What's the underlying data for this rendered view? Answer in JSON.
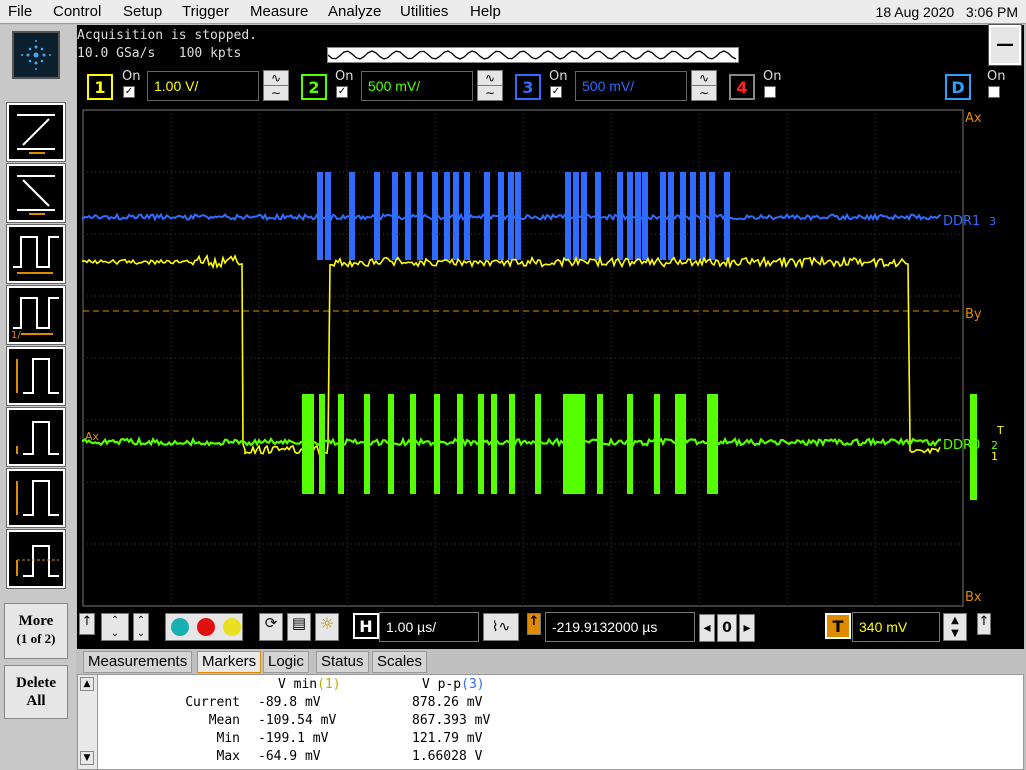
{
  "menu": {
    "items": [
      "File",
      "Control",
      "Setup",
      "Trigger",
      "Measure",
      "Analyze",
      "Utilities",
      "Help"
    ],
    "date": "18 Aug 2020",
    "time": "3:06 PM"
  },
  "acquisition": {
    "status": "Acquisition is stopped.",
    "rate": "10.0 GSa/s",
    "points": "100 kpts"
  },
  "channels": [
    {
      "num": "1",
      "on_label": "On",
      "checked": true,
      "scale": "1.00 V/",
      "color": "#ffff00"
    },
    {
      "num": "2",
      "on_label": "On",
      "checked": true,
      "scale": "500 mV/",
      "color": "#55ff00"
    },
    {
      "num": "3",
      "on_label": "On",
      "checked": true,
      "scale": "500 mV/",
      "color": "#2f6bff"
    },
    {
      "num": "4",
      "on_label": "On",
      "checked": false,
      "scale": "",
      "color": "#ff2020"
    }
  ],
  "digital": {
    "label": "D",
    "on_label": "On",
    "checked": false
  },
  "labels": {
    "ax": "Ax",
    "by": "By",
    "bx": "Bx",
    "ddr1": "DDR1",
    "ddr0": "DDR0",
    "t_marker": "T",
    "ch3_marker": "3",
    "ch2_marker": "2",
    "ch1_marker": "1"
  },
  "left_panel": {
    "more_label": "More",
    "more_sub": "(1 of 2)",
    "delete_label": "Delete",
    "delete_sub": "All"
  },
  "timebase": {
    "h_label": "H",
    "scale": "1.00 µs/",
    "position": "-219.9132000 µs",
    "zero_label": "0",
    "t_label": "T",
    "trigger_level": "340 mV"
  },
  "tabs": [
    {
      "label": "Measurements",
      "active": false
    },
    {
      "label": "Markers",
      "active": true
    },
    {
      "label": "Logic",
      "active": false
    },
    {
      "label": "Status",
      "active": false
    },
    {
      "label": "Scales",
      "active": false
    }
  ],
  "measurements": {
    "header_col1": "V min",
    "header_col1_ch": "(1)",
    "header_col2": "V p-p",
    "header_col2_ch": "(3)",
    "rows": [
      {
        "label": "Current",
        "v1": "-89.8 mV",
        "v2": "878.26 mV"
      },
      {
        "label": "Mean",
        "v1": "-109.54 mV",
        "v2": "867.393 mV"
      },
      {
        "label": "Min",
        "v1": "-199.1 mV",
        "v2": "121.79 mV"
      },
      {
        "label": "Max",
        "v1": "-64.9 mV",
        "v2": "1.66028 V"
      }
    ]
  },
  "colors": {
    "ch1": "#ffff00",
    "ch2": "#55ff00",
    "ch3": "#2f6bff",
    "marker": "#e08a00",
    "grid": "#3a3a3a"
  }
}
